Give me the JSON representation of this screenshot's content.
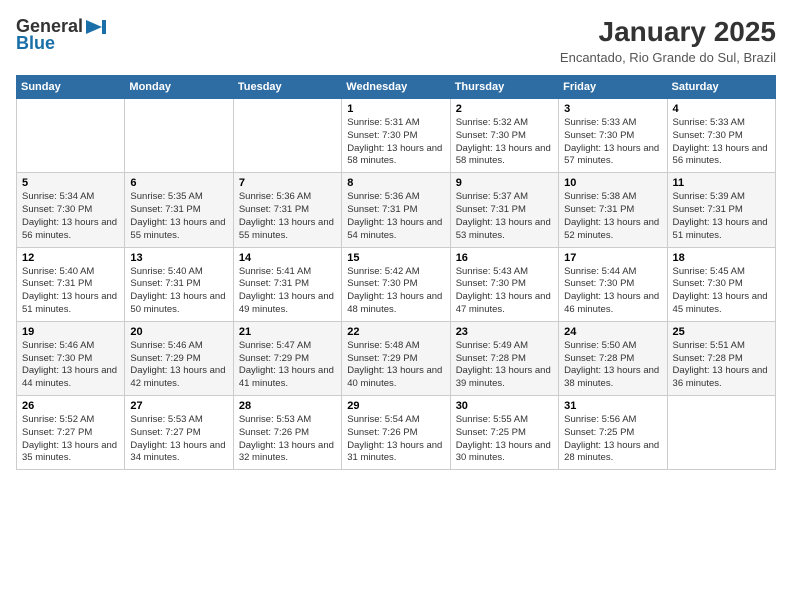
{
  "logo": {
    "general": "General",
    "blue": "Blue"
  },
  "title": {
    "month_year": "January 2025",
    "location": "Encantado, Rio Grande do Sul, Brazil"
  },
  "weekdays": [
    "Sunday",
    "Monday",
    "Tuesday",
    "Wednesday",
    "Thursday",
    "Friday",
    "Saturday"
  ],
  "weeks": [
    [
      {
        "day": null
      },
      {
        "day": null
      },
      {
        "day": null
      },
      {
        "day": "1",
        "sunrise": "5:31 AM",
        "sunset": "7:30 PM",
        "daylight": "13 hours and 58 minutes."
      },
      {
        "day": "2",
        "sunrise": "5:32 AM",
        "sunset": "7:30 PM",
        "daylight": "13 hours and 58 minutes."
      },
      {
        "day": "3",
        "sunrise": "5:33 AM",
        "sunset": "7:30 PM",
        "daylight": "13 hours and 57 minutes."
      },
      {
        "day": "4",
        "sunrise": "5:33 AM",
        "sunset": "7:30 PM",
        "daylight": "13 hours and 56 minutes."
      }
    ],
    [
      {
        "day": "5",
        "sunrise": "5:34 AM",
        "sunset": "7:30 PM",
        "daylight": "13 hours and 56 minutes."
      },
      {
        "day": "6",
        "sunrise": "5:35 AM",
        "sunset": "7:31 PM",
        "daylight": "13 hours and 55 minutes."
      },
      {
        "day": "7",
        "sunrise": "5:36 AM",
        "sunset": "7:31 PM",
        "daylight": "13 hours and 55 minutes."
      },
      {
        "day": "8",
        "sunrise": "5:36 AM",
        "sunset": "7:31 PM",
        "daylight": "13 hours and 54 minutes."
      },
      {
        "day": "9",
        "sunrise": "5:37 AM",
        "sunset": "7:31 PM",
        "daylight": "13 hours and 53 minutes."
      },
      {
        "day": "10",
        "sunrise": "5:38 AM",
        "sunset": "7:31 PM",
        "daylight": "13 hours and 52 minutes."
      },
      {
        "day": "11",
        "sunrise": "5:39 AM",
        "sunset": "7:31 PM",
        "daylight": "13 hours and 51 minutes."
      }
    ],
    [
      {
        "day": "12",
        "sunrise": "5:40 AM",
        "sunset": "7:31 PM",
        "daylight": "13 hours and 51 minutes."
      },
      {
        "day": "13",
        "sunrise": "5:40 AM",
        "sunset": "7:31 PM",
        "daylight": "13 hours and 50 minutes."
      },
      {
        "day": "14",
        "sunrise": "5:41 AM",
        "sunset": "7:31 PM",
        "daylight": "13 hours and 49 minutes."
      },
      {
        "day": "15",
        "sunrise": "5:42 AM",
        "sunset": "7:30 PM",
        "daylight": "13 hours and 48 minutes."
      },
      {
        "day": "16",
        "sunrise": "5:43 AM",
        "sunset": "7:30 PM",
        "daylight": "13 hours and 47 minutes."
      },
      {
        "day": "17",
        "sunrise": "5:44 AM",
        "sunset": "7:30 PM",
        "daylight": "13 hours and 46 minutes."
      },
      {
        "day": "18",
        "sunrise": "5:45 AM",
        "sunset": "7:30 PM",
        "daylight": "13 hours and 45 minutes."
      }
    ],
    [
      {
        "day": "19",
        "sunrise": "5:46 AM",
        "sunset": "7:30 PM",
        "daylight": "13 hours and 44 minutes."
      },
      {
        "day": "20",
        "sunrise": "5:46 AM",
        "sunset": "7:29 PM",
        "daylight": "13 hours and 42 minutes."
      },
      {
        "day": "21",
        "sunrise": "5:47 AM",
        "sunset": "7:29 PM",
        "daylight": "13 hours and 41 minutes."
      },
      {
        "day": "22",
        "sunrise": "5:48 AM",
        "sunset": "7:29 PM",
        "daylight": "13 hours and 40 minutes."
      },
      {
        "day": "23",
        "sunrise": "5:49 AM",
        "sunset": "7:28 PM",
        "daylight": "13 hours and 39 minutes."
      },
      {
        "day": "24",
        "sunrise": "5:50 AM",
        "sunset": "7:28 PM",
        "daylight": "13 hours and 38 minutes."
      },
      {
        "day": "25",
        "sunrise": "5:51 AM",
        "sunset": "7:28 PM",
        "daylight": "13 hours and 36 minutes."
      }
    ],
    [
      {
        "day": "26",
        "sunrise": "5:52 AM",
        "sunset": "7:27 PM",
        "daylight": "13 hours and 35 minutes."
      },
      {
        "day": "27",
        "sunrise": "5:53 AM",
        "sunset": "7:27 PM",
        "daylight": "13 hours and 34 minutes."
      },
      {
        "day": "28",
        "sunrise": "5:53 AM",
        "sunset": "7:26 PM",
        "daylight": "13 hours and 32 minutes."
      },
      {
        "day": "29",
        "sunrise": "5:54 AM",
        "sunset": "7:26 PM",
        "daylight": "13 hours and 31 minutes."
      },
      {
        "day": "30",
        "sunrise": "5:55 AM",
        "sunset": "7:25 PM",
        "daylight": "13 hours and 30 minutes."
      },
      {
        "day": "31",
        "sunrise": "5:56 AM",
        "sunset": "7:25 PM",
        "daylight": "13 hours and 28 minutes."
      },
      {
        "day": null
      }
    ]
  ]
}
